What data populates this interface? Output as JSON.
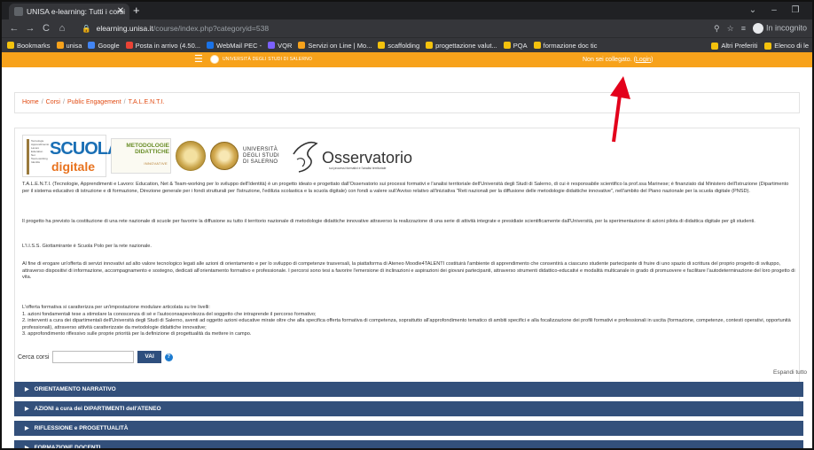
{
  "browser": {
    "tab_title": "UNISA e-learning: Tutti i corsi",
    "url_domain": "elearning.unisa.it",
    "url_path": "/course/index.php?categoryid=538",
    "incognito_label": "In incognito",
    "bookmarks": [
      {
        "label": "Bookmarks",
        "icon": "star-icon",
        "color": "#f4c20d"
      },
      {
        "label": "unisa",
        "icon": "unisa-icon",
        "color": "#f7a21b"
      },
      {
        "label": "Google",
        "icon": "google-icon",
        "color": "#4285f4"
      },
      {
        "label": "Posta in arrivo (4.50...",
        "icon": "gmail-icon",
        "color": "#ea4335"
      },
      {
        "label": "WebMail PEC -",
        "icon": "webmail-icon",
        "color": "#1a73e8"
      },
      {
        "label": "VQR",
        "icon": "vqr-icon",
        "color": "#7b61ff"
      },
      {
        "label": "Servizi on Line | Mo...",
        "icon": "servizi-icon",
        "color": "#f7a21b"
      },
      {
        "label": "scaffolding",
        "icon": "folder-icon",
        "color": "#f4c20d"
      },
      {
        "label": "progettazione valut...",
        "icon": "folder-icon",
        "color": "#f4c20d"
      },
      {
        "label": "PQA",
        "icon": "folder-icon",
        "color": "#f4c20d"
      },
      {
        "label": "formazione doc tic",
        "icon": "folder-icon",
        "color": "#f4c20d"
      }
    ],
    "bookmarks_right": [
      {
        "label": "Altri Preferiti",
        "icon": "folder-icon"
      },
      {
        "label": "Elenco di le",
        "icon": "reading-list-icon"
      }
    ]
  },
  "site": {
    "header_name": "UNIVERSITÀ DEGLI STUDI DI SALERNO",
    "login_prefix": "Non sei collegato. (",
    "login_link": "Login",
    "login_suffix": ")",
    "accent_color": "#f7a21b"
  },
  "breadcrumb": [
    "Home",
    "Corsi",
    "Public Engagement",
    "T.A.L.E.N.T.I."
  ],
  "logos": {
    "scuola_small_lines": "Tecnologie\nApprendimento\nLavoro\nEducation\nNet\nTeam-working\nIdentità",
    "scuola_big": "SCUOLA",
    "scuola_small": "digitale",
    "metodologie_title": "METODOLOGIE DIDATTICHE",
    "metodologie_sub": "INNOVATIVE",
    "universita": "UNIVERSITÀ DEGLI STUDI DI SALERNO",
    "osservatorio": "Osservatorio",
    "osservatorio_sub": "sui processi formativi e l'analisi territoriale"
  },
  "paragraphs": [
    "T.A.L.E.N.T.I. (Tecnologie, Apprendimenti e Lavoro: Education, Net & Team-working per lo sviluppo dell'Identità) è un progetto ideato e progettato dall'Osservatorio sui processi formativi e l'analisi territoriale dell'Università degli Studi di Salerno, di cui è responsabile scientifico la prof.ssa Marinese; è finanziato dal Ministero dell'Istruzione (Dipartimento per il sistema educativo di istruzione e di formazione, Direzione generale per i fondi strutturali per l'istruzione, l'edilizia scolastica e la scuola digitale) con fondi a valere sull'Avviso relativo all'iniziativa \"Reti nazionali per la diffusione delle metodologie didattiche innovative\", nell'ambito del Piano nazionale per la scuola digitale (PNSD).",
    "Il progetto ha previsto la costituzione di una rete nazionale di scuole per favorire la diffusione su tutto il territorio nazionale di metodologie didattiche innovative attraverso la realizzazione di una serie di attività integrate e presidiate scientificamente dall'Università, per la sperimentazione di azioni pilota di didattica digitale per gli studenti.",
    "L'I.I.S.S. Giottamirante è Scuola Polo per la rete nazionale.",
    "Al fine di erogare un'offerta di servizi innovativi ad alto valore tecnologico legati alle azioni di orientamento e per lo sviluppo di competenze trasversali, la piattaforma di Ateneo Moodle4TALENTI costituirà l'ambiente di apprendimento che consentirà a ciascuno studente partecipante di fruire di uno spazio di scrittura del proprio progetto di sviluppo, attraverso dispositivi di informazione, accompagnamento e sostegno, dedicati all'orientamento formativo e professionale. I percorsi sono tesi a favorire l'emersione di inclinazioni e aspirazioni dei giovani partecipanti, attraverso strumenti didattico-educativi e modalità multicanale in grado di promuovere e facilitare l'autodeterminazione del loro progetto di vita.",
    "L'offerta formativa si caratterizza per un'impostazione modulare articolata su tre livelli:\n1. azioni fondamentali tese a stimolare la conoscenza di sé e l'autoconsapevolezza del soggetto che intraprende il percorso formativo;\n2. interventi a cura dei dipartimentali dell'Università degli Studi di Salerno, aventi ad oggetto azioni educative mirate oltre che alla specifica offerta formativa di competenza, soprattutto all'approfondimento tematico di ambiti specifici e alla focalizzazione dei profili formativi e professionali in uscita (formazione, competenze, contesti operativi, opportunità professionali), attraverso attività caratterizzate da metodologie didattiche innovative;\n3. approfondimento riflessivo sulle proprie priorità per la definizione di progettualità da mettere in campo."
  ],
  "search": {
    "label": "Cerca corsi",
    "value": "",
    "button": "VAI"
  },
  "expand_all": "Espandi tutto",
  "categories": [
    "ORIENTAMENTO NARRATIVO",
    "AZIONI a cura dei DIPARTIMENTI dell'ATENEO",
    "RIFLESSIONE e PROGETTUALITÀ",
    "FORMAZIONE DOCENTI"
  ],
  "colors": {
    "category_bg": "#33507b",
    "annotation_arrow": "#e3001b"
  }
}
